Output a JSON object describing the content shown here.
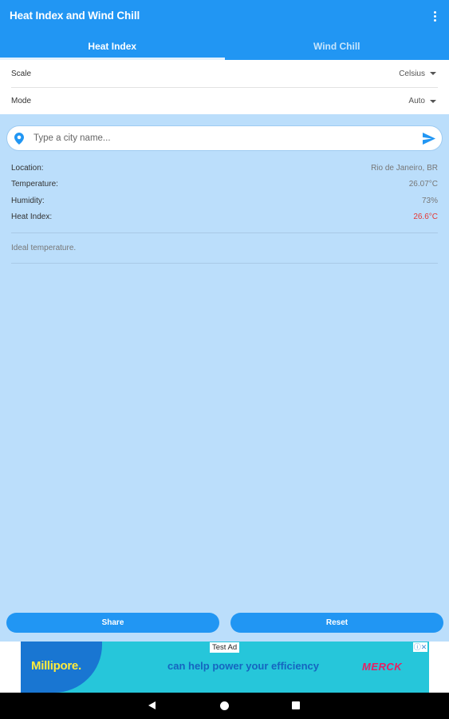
{
  "app": {
    "title": "Heat Index and Wind Chill",
    "menu_icon": "more-vert-icon"
  },
  "tabs": [
    {
      "label": "Heat Index",
      "active": true
    },
    {
      "label": "Wind Chill",
      "active": false
    }
  ],
  "settings": {
    "scale_label": "Scale",
    "scale_value": "Celsius",
    "mode_label": "Mode",
    "mode_value": "Auto"
  },
  "search": {
    "placeholder": "Type a city name...",
    "location_icon": "location-pin-icon",
    "send_icon": "send-icon"
  },
  "info": {
    "location_label": "Location:",
    "location_value": "Rio de Janeiro, BR",
    "temperature_label": "Temperature:",
    "temperature_value": "26.07°C",
    "humidity_label": "Humidity:",
    "humidity_value": "73%",
    "heat_index_label": "Heat Index:",
    "heat_index_value": "26.6°C"
  },
  "note": "Ideal temperature.",
  "buttons": {
    "share_label": "Share",
    "reset_label": "Reset"
  },
  "ad": {
    "badge": "Test Ad",
    "brand": "Millipore.",
    "tagline": "can help power your efficiency",
    "sponsor": "MERCK",
    "close_label": "ⓘ✕"
  },
  "colors": {
    "primary": "#2196f3",
    "background": "#bbdefb",
    "heat_index_value": "#e53935"
  }
}
